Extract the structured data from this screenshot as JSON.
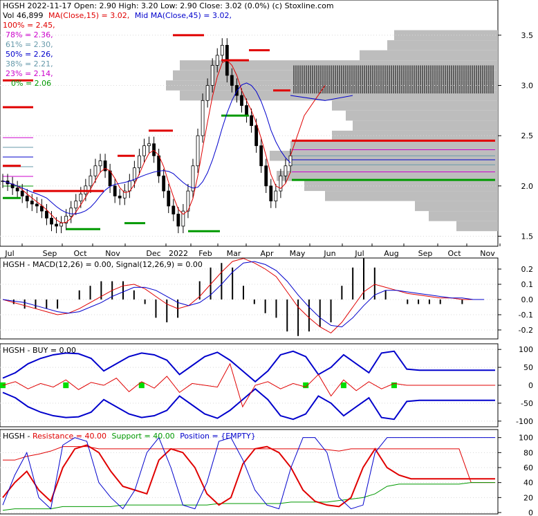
{
  "colors": {
    "black": "#000000",
    "red": "#e00000",
    "green": "#009900",
    "bright_green": "#00dd00",
    "blue": "#0000cc",
    "magenta": "#cc00cc",
    "pink": "#ff66cc",
    "cyan_gray": "#6699aa",
    "volume_profile": "#bdbdbd",
    "grid": "#d8d8d8"
  },
  "chart_data": [
    {
      "type": "candlestick",
      "panel": "price",
      "title": "HGSH  2022-11-17 Open: 2.90  High: 3.20  Low: 2.90  Close: 3.02 (0.0%)  (c) Stoxline.com",
      "volume_line": "Vol 46,899",
      "ma_labels": [
        {
          "text": "MA(Close,15) = 3.02,",
          "color": "#e00000"
        },
        {
          "text": "Mid MA(Close,45) = 3.02,",
          "color": "#0000cc"
        }
      ],
      "fib_levels": [
        {
          "label": "100% = 2.45,",
          "value": 2.45,
          "color": "#e00000"
        },
        {
          "label": "78% = 2.36,",
          "value": 2.36,
          "color": "#cc00cc"
        },
        {
          "label": "61% = 2.30,",
          "value": 2.3,
          "color": "#6699aa"
        },
        {
          "label": "50% = 2.26,",
          "value": 2.26,
          "color": "#0000cc"
        },
        {
          "label": "38% = 2.21,",
          "value": 2.21,
          "color": "#6699aa"
        },
        {
          "label": "23% = 2.14,",
          "value": 2.14,
          "color": "#cc00cc"
        },
        {
          "label": "0% = 2.06",
          "value": 2.06,
          "color": "#009900"
        }
      ],
      "x_tick_labels": [
        "Jul",
        "Sep",
        "Oct",
        "Nov",
        "Dec",
        "2022",
        "Feb",
        "Mar",
        "Apr",
        "May",
        "Jun",
        "Jul",
        "Aug",
        "Sep",
        "Oct",
        "Nov"
      ],
      "y_ticks": [
        1.5,
        2.0,
        2.5,
        3.0,
        3.5
      ],
      "y_tick_labels": [
        "1.5",
        "2.0",
        "2.5",
        "3.0",
        "3.5"
      ],
      "ylim": [
        1.4,
        3.85
      ],
      "close_series": [
        2.05,
        2.02,
        1.98,
        1.95,
        1.9,
        1.85,
        1.82,
        1.8,
        1.75,
        1.68,
        1.62,
        1.6,
        1.63,
        1.7,
        1.78,
        1.85,
        1.92,
        2.0,
        2.1,
        2.2,
        2.25,
        2.15,
        2.0,
        1.9,
        1.88,
        1.95,
        2.05,
        2.18,
        2.3,
        2.4,
        2.42,
        2.3,
        2.1,
        1.95,
        1.8,
        1.72,
        1.6,
        1.75,
        1.95,
        2.2,
        2.5,
        2.85,
        3.0,
        3.2,
        3.3,
        3.4,
        3.1,
        3.0,
        2.9,
        2.8,
        2.7,
        2.6,
        2.4,
        2.2,
        2.0,
        1.85,
        1.95,
        2.1,
        2.2,
        2.3
      ],
      "support_line": 2.06,
      "resistance_line": 2.45
    },
    {
      "type": "line",
      "panel": "macd",
      "title": "HGSH - MACD(12,26) = 0.00, Signal(12,26,9) = 0.00",
      "series": [
        {
          "name": "MACD(12,26)",
          "color": "#e00000",
          "values": [
            0,
            -0.02,
            -0.04,
            -0.06,
            -0.08,
            -0.1,
            -0.09,
            -0.06,
            -0.02,
            0.02,
            0.06,
            0.09,
            0.1,
            0.07,
            0.02,
            -0.03,
            -0.06,
            -0.04,
            0.02,
            0.1,
            0.18,
            0.25,
            0.27,
            0.24,
            0.2,
            0.15,
            0.05,
            -0.05,
            -0.12,
            -0.18,
            -0.22,
            -0.15,
            -0.05,
            0.05,
            0.1,
            0.08,
            0.06,
            0.04,
            0.03,
            0.02,
            0.01,
            0.01,
            0,
            0,
            0
          ]
        },
        {
          "name": "Signal(12,26,9)",
          "color": "#0000cc",
          "values": [
            0,
            -0.01,
            -0.02,
            -0.04,
            -0.06,
            -0.08,
            -0.09,
            -0.08,
            -0.05,
            -0.02,
            0.02,
            0.05,
            0.08,
            0.08,
            0.06,
            0.02,
            -0.02,
            -0.04,
            -0.02,
            0.03,
            0.1,
            0.18,
            0.24,
            0.25,
            0.23,
            0.19,
            0.12,
            0.03,
            -0.05,
            -0.12,
            -0.17,
            -0.18,
            -0.12,
            -0.04,
            0.03,
            0.06,
            0.06,
            0.05,
            0.04,
            0.03,
            0.02,
            0.01,
            0.01,
            0,
            0
          ]
        }
      ],
      "y_ticks": [
        0.2,
        0.1,
        0.0,
        -0.1,
        -0.2
      ],
      "y_tick_labels": [
        "0.2",
        "0.1",
        "0.0",
        "-0.1",
        "-0.2"
      ],
      "ylim": [
        -0.25,
        0.25
      ]
    },
    {
      "type": "line",
      "panel": "buy",
      "title": "HGSH - BUY = 0.00",
      "series": [
        {
          "name": "upper",
          "color": "#0000cc",
          "values": [
            20,
            35,
            60,
            75,
            85,
            90,
            88,
            75,
            40,
            60,
            80,
            90,
            85,
            70,
            30,
            55,
            80,
            92,
            70,
            40,
            10,
            40,
            85,
            95,
            80,
            30,
            50,
            85,
            60,
            35,
            90,
            95,
            45,
            42,
            42,
            42,
            42,
            42,
            42,
            42
          ]
        },
        {
          "name": "lower",
          "color": "#0000cc",
          "values": [
            -20,
            -35,
            -60,
            -75,
            -85,
            -90,
            -88,
            -75,
            -40,
            -60,
            -80,
            -90,
            -85,
            -70,
            -30,
            -55,
            -80,
            -92,
            -70,
            -40,
            -10,
            -40,
            -85,
            -95,
            -80,
            -30,
            -50,
            -85,
            -60,
            -35,
            -90,
            -95,
            -45,
            -42,
            -42,
            -42,
            -42,
            -42,
            -42,
            -42
          ]
        },
        {
          "name": "signal",
          "color": "#e00000",
          "values": [
            0,
            10,
            -10,
            5,
            -5,
            15,
            -12,
            8,
            0,
            20,
            -18,
            10,
            -8,
            25,
            -20,
            5,
            0,
            -5,
            60,
            -60,
            0,
            10,
            -10,
            5,
            -5,
            30,
            -30,
            15,
            -15,
            10,
            -10,
            5,
            0,
            0,
            0,
            0,
            0,
            0,
            0,
            0
          ]
        }
      ],
      "buy_markers_at_index": [
        0,
        5,
        11,
        24,
        27,
        31
      ],
      "y_ticks": [
        100,
        50,
        0,
        -50,
        -100
      ],
      "y_tick_labels": [
        "100",
        "50",
        "0",
        "-50",
        "-100"
      ],
      "ylim": [
        -110,
        110
      ]
    },
    {
      "type": "line",
      "panel": "resistance_support",
      "title_parts": {
        "prefix": "HGSH - ",
        "resistance": "Resistance = 40.00",
        "support": "Support = 40.00",
        "position": "Position = {EMPTY}"
      },
      "series": [
        {
          "name": "Resistance",
          "color": "#e00000",
          "values": [
            70,
            70,
            75,
            78,
            82,
            88,
            88,
            88,
            85,
            85,
            85,
            85,
            85,
            85,
            85,
            85,
            85,
            85,
            85,
            85,
            85,
            85,
            85,
            85,
            85,
            85,
            85,
            84,
            82,
            85,
            85,
            85,
            85,
            85,
            85,
            85,
            85,
            85,
            85,
            40,
            40,
            40
          ]
        },
        {
          "name": "Support",
          "color": "#009900",
          "values": [
            3,
            5,
            5,
            5,
            5,
            8,
            8,
            8,
            8,
            8,
            10,
            10,
            10,
            10,
            10,
            10,
            10,
            10,
            12,
            12,
            12,
            12,
            12,
            12,
            14,
            14,
            14,
            14,
            16,
            18,
            20,
            25,
            35,
            38,
            38,
            38,
            38,
            38,
            38,
            40,
            40,
            40
          ]
        },
        {
          "name": "Oscillator",
          "color": "#e00000",
          "values": [
            20,
            40,
            55,
            30,
            15,
            60,
            85,
            90,
            80,
            55,
            35,
            30,
            25,
            70,
            85,
            80,
            60,
            25,
            10,
            20,
            65,
            85,
            88,
            80,
            60,
            30,
            15,
            10,
            8,
            20,
            60,
            85,
            60,
            50,
            45,
            45,
            45,
            45,
            45,
            45,
            45,
            45
          ]
        },
        {
          "name": "Position",
          "color": "#0000cc",
          "values": [
            10,
            50,
            80,
            20,
            5,
            90,
            100,
            95,
            40,
            20,
            5,
            30,
            80,
            100,
            60,
            10,
            5,
            40,
            95,
            100,
            70,
            30,
            10,
            5,
            60,
            100,
            100,
            80,
            20,
            5,
            10,
            80,
            100,
            100,
            100,
            100,
            100,
            100,
            100,
            100,
            100,
            100
          ]
        }
      ],
      "y_ticks": [
        100,
        80,
        60,
        40,
        20,
        0
      ],
      "y_tick_labels": [
        "100",
        "80",
        "60",
        "40",
        "20",
        "0"
      ],
      "ylim": [
        0,
        108
      ]
    }
  ]
}
